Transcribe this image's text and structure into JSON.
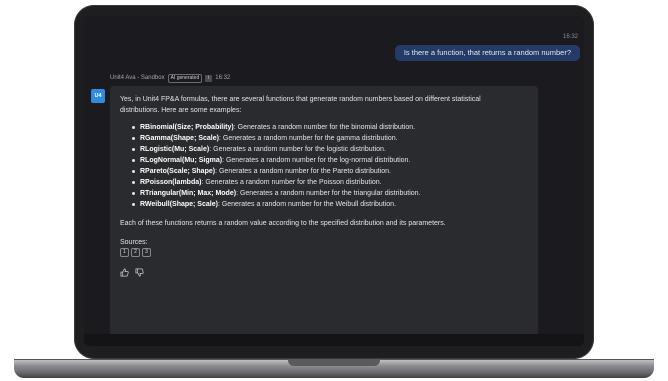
{
  "user_message": {
    "time": "16:32",
    "text": "Is there a function, that returns a random number?"
  },
  "assistant": {
    "name": "Unit4 Ava - Sandbox",
    "badge": "AI generated",
    "time": "16:32",
    "avatar": "U4",
    "intro": "Yes, in Unit4 FP&A formulas, there are several functions that generate random numbers based on different statistical distributions. Here are some examples:",
    "items": [
      {
        "fn": "RBinomial(Size; Probability)",
        "desc": ": Generates a random number for the binomial distribution."
      },
      {
        "fn": "RGamma(Shape; Scale)",
        "desc": ": Generates a random number for the gamma distribution."
      },
      {
        "fn": "RLogistic(Mu; Scale)",
        "desc": ": Generates a random number for the logistic distribution."
      },
      {
        "fn": "RLogNormal(Mu; Sigma)",
        "desc": ": Generates a random number for the log-normal distribution."
      },
      {
        "fn": "RPareto(Scale; Shape)",
        "desc": ": Generates a random number for the Pareto distribution."
      },
      {
        "fn": "RPoisson(lambda)",
        "desc": ": Generates a random number for the Poisson distribution."
      },
      {
        "fn": "RTriangular(Min; Max; Mode)",
        "desc": ": Generates a random number for the triangular distribution."
      },
      {
        "fn": "RWeibull(Shape; Scale)",
        "desc": ": Generates a random number for the Weibull distribution."
      }
    ],
    "outro": "Each of these functions returns a random value according to the specified distribution and its parameters.",
    "sources_label": "Sources:",
    "sources": [
      "1",
      "2",
      "3"
    ]
  },
  "colors": {
    "user_bubble": "#243a67",
    "avatar": "#2f8ae0",
    "card": "#2a2b2f",
    "screen": "#1b1b1f"
  }
}
